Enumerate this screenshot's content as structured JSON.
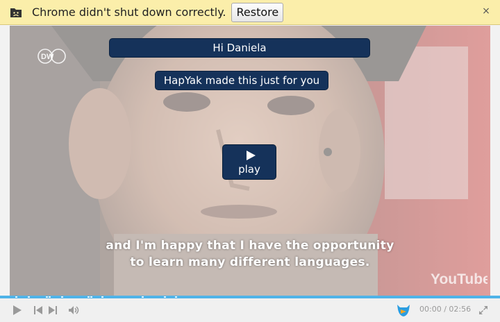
{
  "infobar": {
    "message": "Chrome didn't shut down correctly.",
    "restore_label": "Restore",
    "close_glyph": "×",
    "icon": "sad-folder-icon"
  },
  "overlay": {
    "greeting": "Hi Daniela",
    "tagline": "HapYak made this just for you",
    "play_label": "play"
  },
  "video": {
    "subtitle_lines": [
      "and I'm happy that I have the opportunity",
      "to learn many different languages."
    ],
    "channel_logo": "DW",
    "watermark": "YouTube"
  },
  "player": {
    "current_time": "00:00",
    "separator": "/",
    "duration": "02:56",
    "accent_color": "#4fb3e8",
    "controls": [
      "play-icon",
      "previous-icon",
      "next-icon",
      "volume-icon",
      "hapyak-logo-icon",
      "fullscreen-icon"
    ]
  },
  "colors": {
    "infobar_bg": "#fbeeaa",
    "overlay_button_bg": "#15325a"
  }
}
